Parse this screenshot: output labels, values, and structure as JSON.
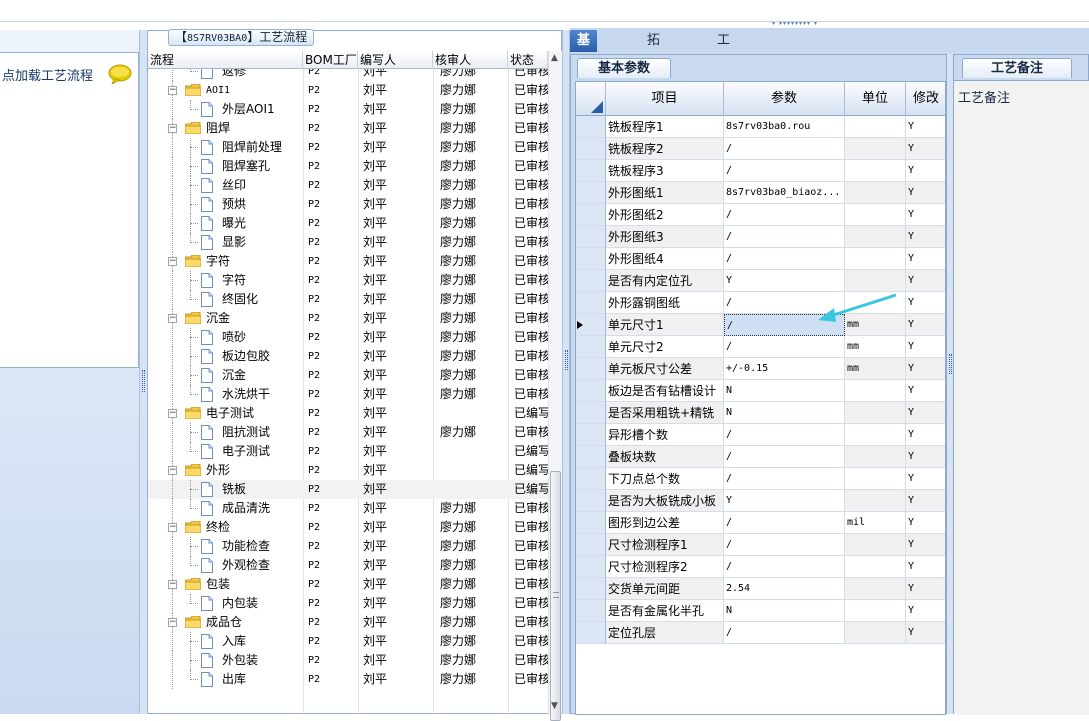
{
  "left_panel": {
    "label": "点加载工艺流程"
  },
  "flow_panel": {
    "title_prefix": "【",
    "title_code": "8S7RV03BA0",
    "title_suffix": "】工艺流程",
    "columns": [
      "流程",
      "BOM工厂",
      "编写人",
      "核审人",
      "状态"
    ],
    "rows": [
      {
        "level": 2,
        "name": "返修",
        "bom": "P2",
        "writer": "刘平",
        "reviewer": "廖力娜",
        "status": "已审核"
      },
      {
        "level": 1,
        "name": "AOI1",
        "bom": "P2",
        "writer": "刘平",
        "reviewer": "廖力娜",
        "status": "已审核"
      },
      {
        "level": 2,
        "name": "外层AOI1",
        "bom": "P2",
        "writer": "刘平",
        "reviewer": "廖力娜",
        "status": "已审核"
      },
      {
        "level": 1,
        "name": "阻焊",
        "bom": "P2",
        "writer": "刘平",
        "reviewer": "廖力娜",
        "status": "已审核"
      },
      {
        "level": 2,
        "name": "阻焊前处理",
        "bom": "P2",
        "writer": "刘平",
        "reviewer": "廖力娜",
        "status": "已审核"
      },
      {
        "level": 2,
        "name": "阻焊塞孔",
        "bom": "P2",
        "writer": "刘平",
        "reviewer": "廖力娜",
        "status": "已审核"
      },
      {
        "level": 2,
        "name": "丝印",
        "bom": "P2",
        "writer": "刘平",
        "reviewer": "廖力娜",
        "status": "已审核"
      },
      {
        "level": 2,
        "name": "预烘",
        "bom": "P2",
        "writer": "刘平",
        "reviewer": "廖力娜",
        "status": "已审核"
      },
      {
        "level": 2,
        "name": "曝光",
        "bom": "P2",
        "writer": "刘平",
        "reviewer": "廖力娜",
        "status": "已审核"
      },
      {
        "level": 2,
        "name": "显影",
        "bom": "P2",
        "writer": "刘平",
        "reviewer": "廖力娜",
        "status": "已审核"
      },
      {
        "level": 1,
        "name": "字符",
        "bom": "P2",
        "writer": "刘平",
        "reviewer": "廖力娜",
        "status": "已审核"
      },
      {
        "level": 2,
        "name": "字符",
        "bom": "P2",
        "writer": "刘平",
        "reviewer": "廖力娜",
        "status": "已审核"
      },
      {
        "level": 2,
        "name": "终固化",
        "bom": "P2",
        "writer": "刘平",
        "reviewer": "廖力娜",
        "status": "已审核"
      },
      {
        "level": 1,
        "name": "沉金",
        "bom": "P2",
        "writer": "刘平",
        "reviewer": "廖力娜",
        "status": "已审核"
      },
      {
        "level": 2,
        "name": "喷砂",
        "bom": "P2",
        "writer": "刘平",
        "reviewer": "廖力娜",
        "status": "已审核"
      },
      {
        "level": 2,
        "name": "板边包胶",
        "bom": "P2",
        "writer": "刘平",
        "reviewer": "廖力娜",
        "status": "已审核"
      },
      {
        "level": 2,
        "name": "沉金",
        "bom": "P2",
        "writer": "刘平",
        "reviewer": "廖力娜",
        "status": "已审核"
      },
      {
        "level": 2,
        "name": "水洗烘干",
        "bom": "P2",
        "writer": "刘平",
        "reviewer": "廖力娜",
        "status": "已审核"
      },
      {
        "level": 1,
        "name": "电子测试",
        "bom": "P2",
        "writer": "刘平",
        "reviewer": "",
        "status": "已编写"
      },
      {
        "level": 2,
        "name": "阻抗测试",
        "bom": "P2",
        "writer": "刘平",
        "reviewer": "廖力娜",
        "status": "已审核"
      },
      {
        "level": 2,
        "name": "电子测试",
        "bom": "P2",
        "writer": "刘平",
        "reviewer": "",
        "status": "已编写"
      },
      {
        "level": 1,
        "name": "外形",
        "bom": "P2",
        "writer": "刘平",
        "reviewer": "",
        "status": "已编写"
      },
      {
        "level": 2,
        "name": "铣板",
        "bom": "P2",
        "writer": "刘平",
        "reviewer": "",
        "status": "已编写",
        "selected": true
      },
      {
        "level": 2,
        "name": "成品清洗",
        "bom": "P2",
        "writer": "刘平",
        "reviewer": "廖力娜",
        "status": "已审核"
      },
      {
        "level": 1,
        "name": "终检",
        "bom": "P2",
        "writer": "刘平",
        "reviewer": "廖力娜",
        "status": "已审核"
      },
      {
        "level": 2,
        "name": "功能检查",
        "bom": "P2",
        "writer": "刘平",
        "reviewer": "廖力娜",
        "status": "已审核"
      },
      {
        "level": 2,
        "name": "外观检查",
        "bom": "P2",
        "writer": "刘平",
        "reviewer": "廖力娜",
        "status": "已审核"
      },
      {
        "level": 1,
        "name": "包装",
        "bom": "P2",
        "writer": "刘平",
        "reviewer": "廖力娜",
        "status": "已审核"
      },
      {
        "level": 2,
        "name": "内包装",
        "bom": "P2",
        "writer": "刘平",
        "reviewer": "廖力娜",
        "status": "已审核"
      },
      {
        "level": 1,
        "name": "成品仓",
        "bom": "P2",
        "writer": "刘平",
        "reviewer": "廖力娜",
        "status": "已审核"
      },
      {
        "level": 2,
        "name": "入库",
        "bom": "P2",
        "writer": "刘平",
        "reviewer": "廖力娜",
        "status": "已审核"
      },
      {
        "level": 2,
        "name": "外包装",
        "bom": "P2",
        "writer": "刘平",
        "reviewer": "廖力娜",
        "status": "已审核"
      },
      {
        "level": 2,
        "name": "出库",
        "bom": "P2",
        "writer": "刘平",
        "reviewer": "廖力娜",
        "status": "已审核"
      }
    ]
  },
  "right_panel": {
    "tabs": [
      "基本信息",
      "拓展信息",
      "工时"
    ],
    "active_tab": 0,
    "basic_tab_label": "基本参数",
    "columns": [
      "项目",
      "参数",
      "单位",
      "修改"
    ],
    "rows": [
      {
        "item": "铣板程序1",
        "param": "8s7rv03ba0.rou",
        "unit": "",
        "mod": "Y"
      },
      {
        "item": "铣板程序2",
        "param": "/",
        "unit": "",
        "mod": "Y"
      },
      {
        "item": "铣板程序3",
        "param": "/",
        "unit": "",
        "mod": "Y"
      },
      {
        "item": "外形图纸1",
        "param": "8s7rv03ba0_biaoz...",
        "unit": "",
        "mod": "Y"
      },
      {
        "item": "外形图纸2",
        "param": "/",
        "unit": "",
        "mod": "Y"
      },
      {
        "item": "外形图纸3",
        "param": "/",
        "unit": "",
        "mod": "Y"
      },
      {
        "item": "外形图纸4",
        "param": "/",
        "unit": "",
        "mod": "Y"
      },
      {
        "item": "是否有内定位孔",
        "param": "Y",
        "unit": "",
        "mod": "Y"
      },
      {
        "item": "外形露铜图纸",
        "param": "/",
        "unit": "",
        "mod": "Y"
      },
      {
        "item": "单元尺寸1",
        "param": "/",
        "unit": "mm",
        "mod": "Y",
        "current": true
      },
      {
        "item": "单元尺寸2",
        "param": "/",
        "unit": "mm",
        "mod": "Y"
      },
      {
        "item": "单元板尺寸公差",
        "param": "+/-0.15",
        "unit": "mm",
        "mod": "Y"
      },
      {
        "item": "板边是否有钻槽设计",
        "param": "N",
        "unit": "",
        "mod": "Y"
      },
      {
        "item": "是否采用粗铣+精铣",
        "param": "N",
        "unit": "",
        "mod": "Y"
      },
      {
        "item": "异形槽个数",
        "param": "/",
        "unit": "",
        "mod": "Y"
      },
      {
        "item": "叠板块数",
        "param": "/",
        "unit": "",
        "mod": "Y"
      },
      {
        "item": "下刀点总个数",
        "param": "/",
        "unit": "",
        "mod": "Y"
      },
      {
        "item": "是否为大板铣成小板",
        "param": "Y",
        "unit": "",
        "mod": "Y"
      },
      {
        "item": "图形到边公差",
        "param": "/",
        "unit": "mil",
        "mod": "Y"
      },
      {
        "item": "尺寸检测程序1",
        "param": "/",
        "unit": "",
        "mod": "Y"
      },
      {
        "item": "尺寸检测程序2",
        "param": "/",
        "unit": "",
        "mod": "Y"
      },
      {
        "item": "交货单元间距",
        "param": "2.54",
        "unit": "",
        "mod": "Y"
      },
      {
        "item": "是否有金属化半孔",
        "param": "N",
        "unit": "",
        "mod": "Y"
      },
      {
        "item": "定位孔层",
        "param": "/",
        "unit": "",
        "mod": "Y"
      }
    ],
    "note_tab_label": "工艺备注",
    "note_label": "工艺备注"
  },
  "icons": {
    "bubble": "speech-bubble-icon",
    "folder": "folder-icon",
    "doc": "document-icon",
    "arrow": "annotation-arrow-icon"
  },
  "colors": {
    "tab_active": "#2a5ea8",
    "panel_bg": "#c9daf0",
    "folder": "#f2c54b",
    "bubble": "#e5cc00",
    "arrow": "#37c8e0"
  }
}
